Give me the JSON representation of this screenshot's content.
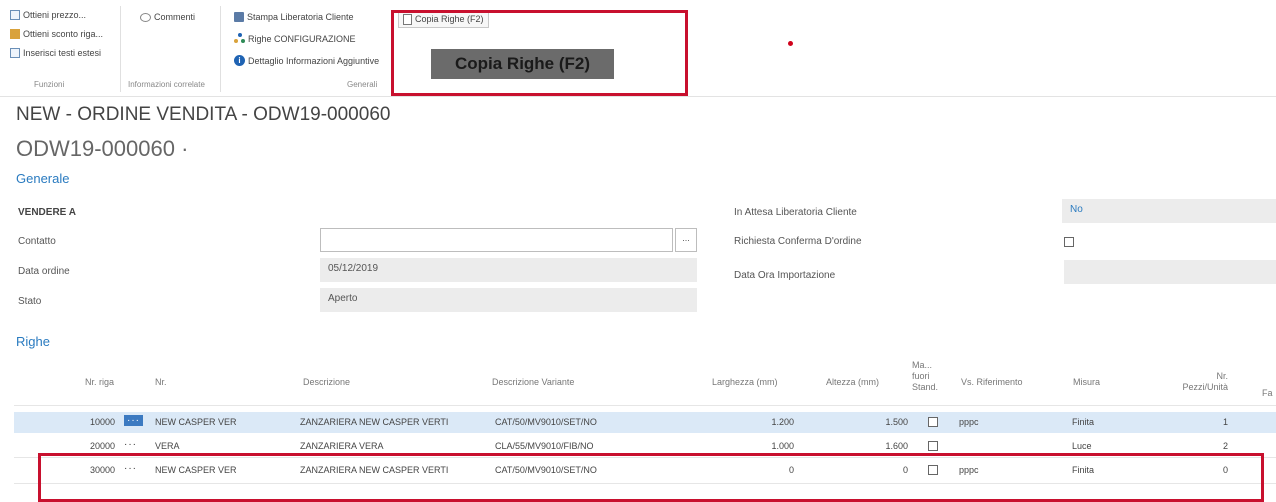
{
  "ribbon": {
    "funzioni": {
      "items": [
        "Ottieni prezzo...",
        "Ottieni sconto riga...",
        "Inserisci testi estesi"
      ],
      "label": "Funzioni"
    },
    "info": {
      "items": [
        "Commenti"
      ],
      "label": "Informazioni correlate"
    },
    "generali": {
      "items": [
        "Stampa Liberatoria Cliente",
        "Righe CONFIGURAZIONE",
        "Dettaglio Informazioni Aggiuntive"
      ],
      "label": "Generali"
    },
    "copy_button": "Copia Righe (F2)",
    "tooltip": "Copia Righe (F2)"
  },
  "page": {
    "title": "NEW - ORDINE VENDITA - ODW19-000060",
    "subtitle": "ODW19-000060 ·"
  },
  "generale": {
    "section": "Generale",
    "left": {
      "vendere_a": "VENDERE A",
      "contatto_label": "Contatto",
      "contatto_value": "",
      "lookup": "...",
      "data_ordine_label": "Data ordine",
      "data_ordine_value": "05/12/2019",
      "stato_label": "Stato",
      "stato_value": "Aperto"
    },
    "right": {
      "attesa_label": "In Attesa Liberatoria Cliente",
      "attesa_value": "No",
      "conferma_label": "Richiesta Conferma D'ordine",
      "conferma_checked": false,
      "data_ora_label": "Data Ora Importazione",
      "data_ora_value": ""
    }
  },
  "righe": {
    "section": "Righe",
    "columns": [
      "Nr. riga",
      "Nr.",
      "Descrizione",
      "Descrizione Variante",
      "Larghezza (mm)",
      "Altezza (mm)",
      "Ma... fuori Stand.",
      "Vs. Riferimento",
      "Misura",
      "Nr. Pezzi/Unità",
      "Fa"
    ],
    "rows": [
      {
        "nr_riga": "10000",
        "nr": "NEW CASPER VER",
        "descrizione": "ZANZARIERA NEW CASPER VERTI",
        "variante": "CAT/50/MV9010/SET/NO",
        "larghezza": "1.200",
        "altezza": "1.500",
        "rif": "pppc",
        "misura": "Finita",
        "pezzi": "1"
      },
      {
        "nr_riga": "20000",
        "nr": "VERA",
        "descrizione": "ZANZARIERA VERA",
        "variante": "CLA/55/MV9010/FIB/NO",
        "larghezza": "1.000",
        "altezza": "1.600",
        "rif": "",
        "misura": "Luce",
        "pezzi": "2"
      },
      {
        "nr_riga": "30000",
        "nr": "NEW CASPER VER",
        "descrizione": "ZANZARIERA NEW CASPER VERTI",
        "variante": "CAT/50/MV9010/SET/NO",
        "larghezza": "0",
        "altezza": "0",
        "rif": "pppc",
        "misura": "Finita",
        "pezzi": "0"
      }
    ],
    "dots": "···"
  },
  "colors": {
    "accent": "#2a7bc0",
    "highlight": "#c8102e",
    "selected_row": "#dbe9f7"
  }
}
